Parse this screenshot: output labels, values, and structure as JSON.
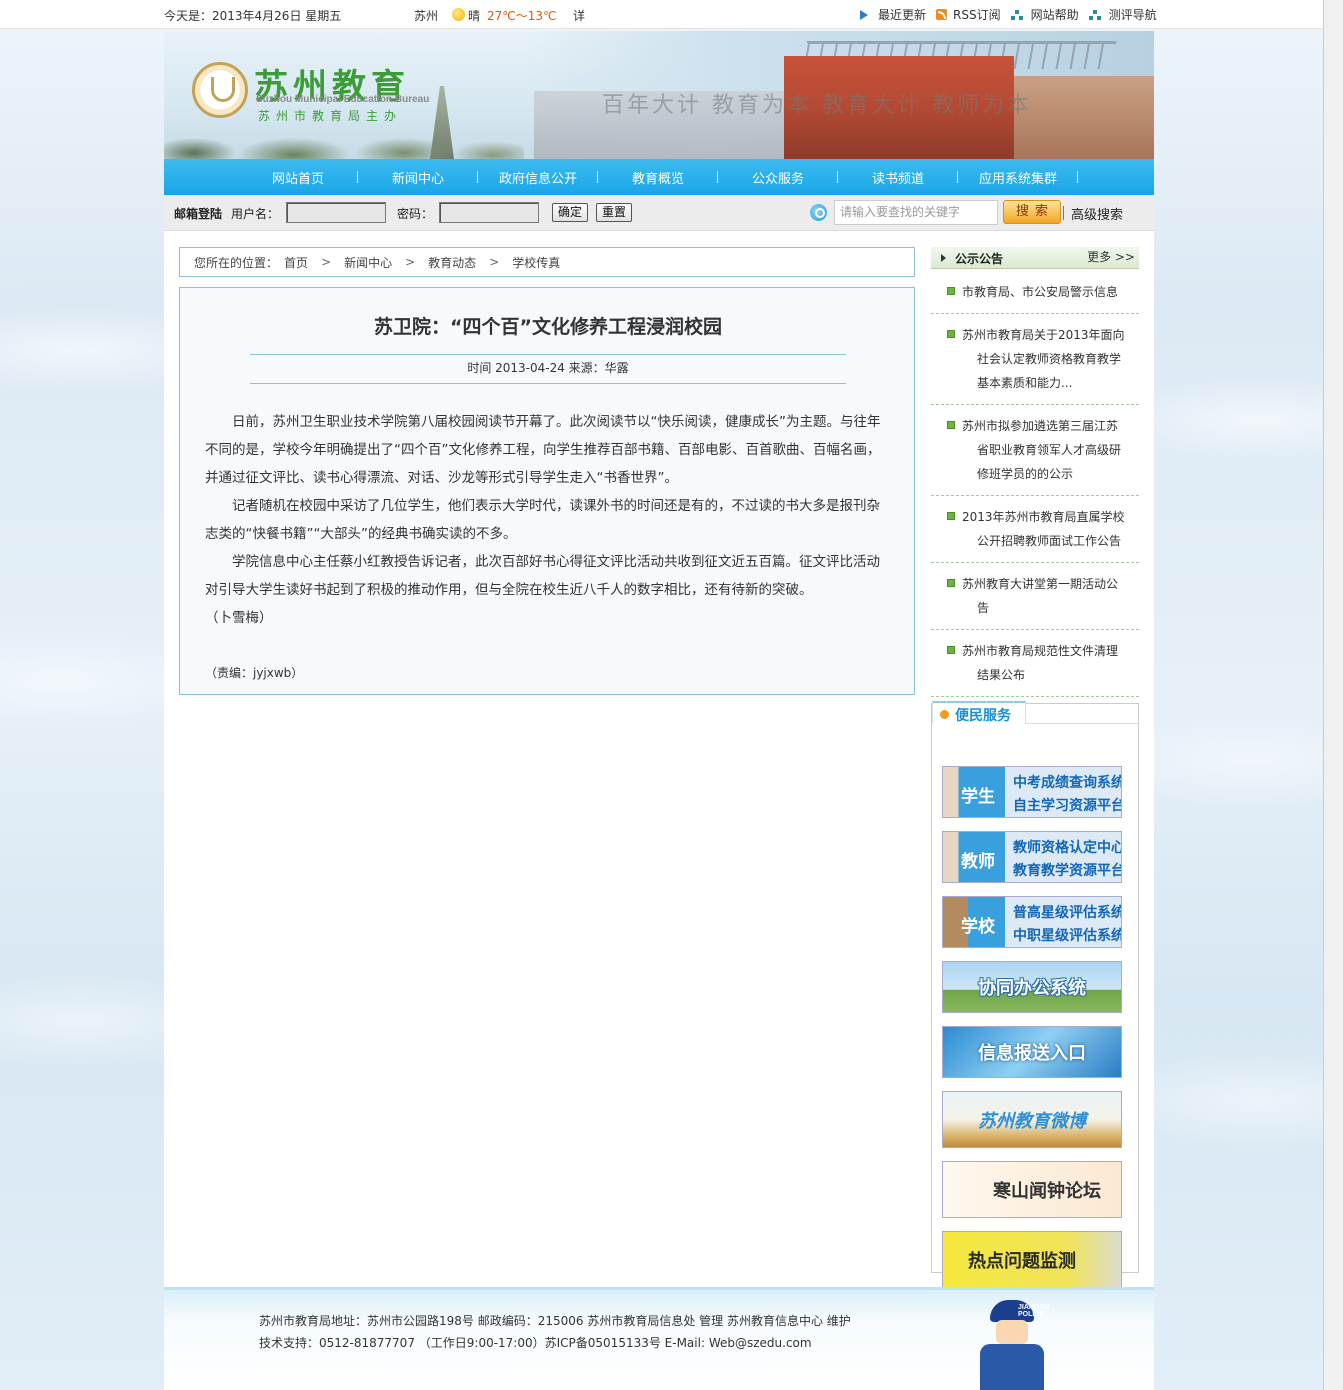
{
  "topbar": {
    "date": "今天是：2013年4月26日  星期五",
    "city": "苏州",
    "weather": "晴",
    "temp": "27℃～13℃",
    "detail": "详",
    "links": [
      "最近更新",
      "RSS订阅",
      "网站帮助",
      "测评导航"
    ]
  },
  "banner": {
    "title": "苏州教育",
    "en": "Suzhou Municipal Education Bureau",
    "sub": "苏州市教育局主办",
    "slogan": "百年大计  教育为本  教育大计  教师为本"
  },
  "nav": [
    "网站首页",
    "新闻中心",
    "政府信息公开",
    "教育概览",
    "公众服务",
    "读书频道",
    "应用系统集群"
  ],
  "login": {
    "label": "邮箱登陆",
    "user_label": "用户名：",
    "pass_label": "密码：",
    "ok": "确定",
    "reset": "重置",
    "search_placeholder": "请输入要查找的关键字",
    "search_btn": "搜索",
    "adv": "高级搜索"
  },
  "breadcrumb": {
    "prefix": "您所在的位置：",
    "items": [
      "首页",
      "新闻中心",
      "教育动态",
      "学校传真"
    ],
    "sep": ">"
  },
  "article": {
    "title": "苏卫院：“四个百”文化修养工程浸润校园",
    "meta": "时间 2013-04-24 来源：华露",
    "p1": "日前，苏州卫生职业技术学院第八届校园阅读节开幕了。此次阅读节以“快乐阅读，健康成长”为主题。与往年不同的是，学校今年明确提出了“四个百”文化修养工程，向学生推荐百部书籍、百部电影、百首歌曲、百幅名画，并通过征文评比、读书心得漂流、对话、沙龙等形式引导学生走入“书香世界”。",
    "p2": "记者随机在校园中采访了几位学生，他们表示大学时代，读课外书的时间还是有的，不过读的书大多是报刊杂志类的“快餐书籍”“大部头”的经典书确实读的不多。",
    "p3": "学院信息中心主任蔡小红教授告诉记者，此次百部好书心得征文评比活动共收到征文近五百篇。征文评比活动对引导大学生读好书起到了积极的推动作用，但与全院在校生近八千人的数字相比，还有待新的突破。",
    "author": "（卜雪梅）",
    "editor": "（责编：jyjxwb）"
  },
  "notice": {
    "title": "公示公告",
    "more": "更多 >>",
    "items": [
      "市教育局、市公安局警示信息",
      "苏州市教育局关于2013年面向社会认定教师资格教育教学基本素质和能力...",
      "苏州市拟参加遴选第三届江苏省职业教育领军人才高级研修班学员的的公示",
      "2013年苏州市教育局直属学校公开招聘教师面试工作公告",
      "苏州教育大讲堂第一期活动公告",
      "苏州市教育局规范性文件清理结果公布"
    ]
  },
  "services": {
    "title": "便民服务",
    "student": {
      "tag": "学生",
      "l1": "中考成绩查询系统",
      "l2": "自主学习资源平台"
    },
    "teacher": {
      "tag": "教师",
      "l1": "教师资格认定中心",
      "l2": "教育教学资源平台"
    },
    "school": {
      "tag": "学校",
      "l1": "普高星级评估系统",
      "l2": "中职星级评估系统"
    },
    "banners": [
      "协同办公系统",
      "信息报送入口",
      "苏州教育微博",
      "寒山闻钟论坛",
      "热点问题监测"
    ]
  },
  "footer": {
    "line1": "苏州市教育局地址：苏州市公园路198号  邮政编码：215006  苏州市教育局信息处 管理  苏州教育信息中心 维护",
    "line2": "技术支持：0512-81877707 （工作日9:00-17:00）苏ICP备05015133号 E-Mail: Web@szedu.com",
    "police_label": "JIANGSU POLICE"
  }
}
